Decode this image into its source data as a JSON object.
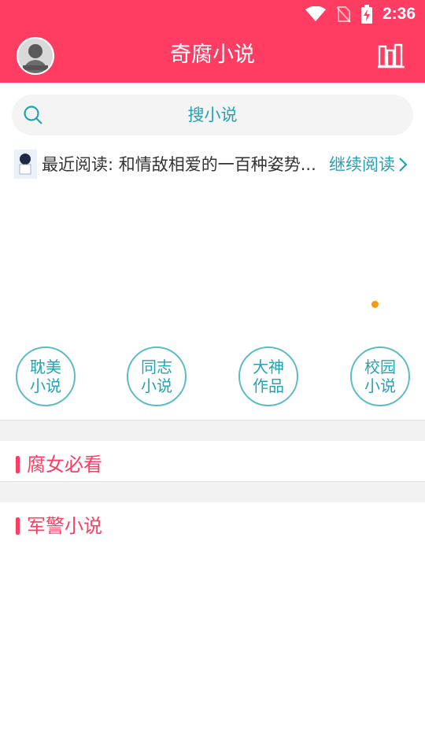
{
  "status_bar": {
    "time": "2:36",
    "icons": [
      "wifi-icon",
      "no-sim-icon",
      "battery-charging-icon"
    ]
  },
  "header": {
    "title": "奇腐小说",
    "avatar_icon": "user-avatar",
    "right_icon": "bookshelf-icon"
  },
  "search": {
    "placeholder": "搜小说",
    "icon": "search-icon"
  },
  "recent": {
    "text": "最近阅读: 和情敌相爱的一百种姿势...",
    "action": "继续阅读"
  },
  "categories": [
    {
      "line1": "耽美",
      "line2": "小说"
    },
    {
      "line1": "同志",
      "line2": "小说"
    },
    {
      "line1": "大神",
      "line2": "作品"
    },
    {
      "line1": "校园",
      "line2": "小说"
    }
  ],
  "sections": [
    {
      "title": "腐女必看"
    },
    {
      "title": "军警小说"
    }
  ],
  "colors": {
    "brand": "#ff3d63",
    "accent": "#26a2b5",
    "indicator": "#f39c12"
  }
}
